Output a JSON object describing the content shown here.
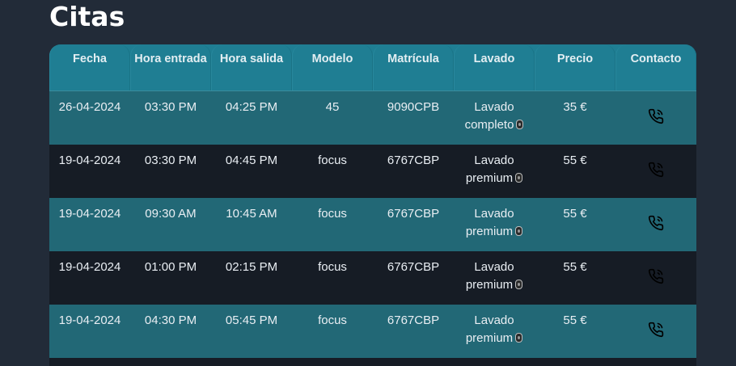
{
  "page": {
    "title": "Citas"
  },
  "table": {
    "headers": [
      "Fecha",
      "Hora entrada",
      "Hora salida",
      "Modelo",
      "Matrícula",
      "Lavado",
      "Precio",
      "Contacto"
    ],
    "rows": [
      {
        "fecha": "26-04-2024",
        "hora_entrada": "03:30 PM",
        "hora_salida": "04:25 PM",
        "modelo": "45",
        "matricula": "9090CPB",
        "lavado": "Lavado completo",
        "precio": "35 €",
        "contacto_icon": "phone-call-icon"
      },
      {
        "fecha": "19-04-2024",
        "hora_entrada": "03:30 PM",
        "hora_salida": "04:45 PM",
        "modelo": "focus",
        "matricula": "6767CBP",
        "lavado": "Lavado premium",
        "precio": "55 €",
        "contacto_icon": "phone-call-icon"
      },
      {
        "fecha": "19-04-2024",
        "hora_entrada": "09:30 AM",
        "hora_salida": "10:45 AM",
        "modelo": "focus",
        "matricula": "6767CBP",
        "lavado": "Lavado premium",
        "precio": "55 €",
        "contacto_icon": "phone-call-icon"
      },
      {
        "fecha": "19-04-2024",
        "hora_entrada": "01:00 PM",
        "hora_salida": "02:15 PM",
        "modelo": "focus",
        "matricula": "6767CBP",
        "lavado": "Lavado premium",
        "precio": "55 €",
        "contacto_icon": "phone-call-icon"
      },
      {
        "fecha": "19-04-2024",
        "hora_entrada": "04:30 PM",
        "hora_salida": "05:45 PM",
        "modelo": "focus",
        "matricula": "6767CBP",
        "lavado": "Lavado premium",
        "precio": "55 €",
        "contacto_icon": "phone-call-icon"
      }
    ]
  },
  "colors": {
    "background": "#222b38",
    "header": "#1f7e93",
    "row_teal": "#226876",
    "row_dark": "#161c25",
    "text": "#e9eef3"
  }
}
